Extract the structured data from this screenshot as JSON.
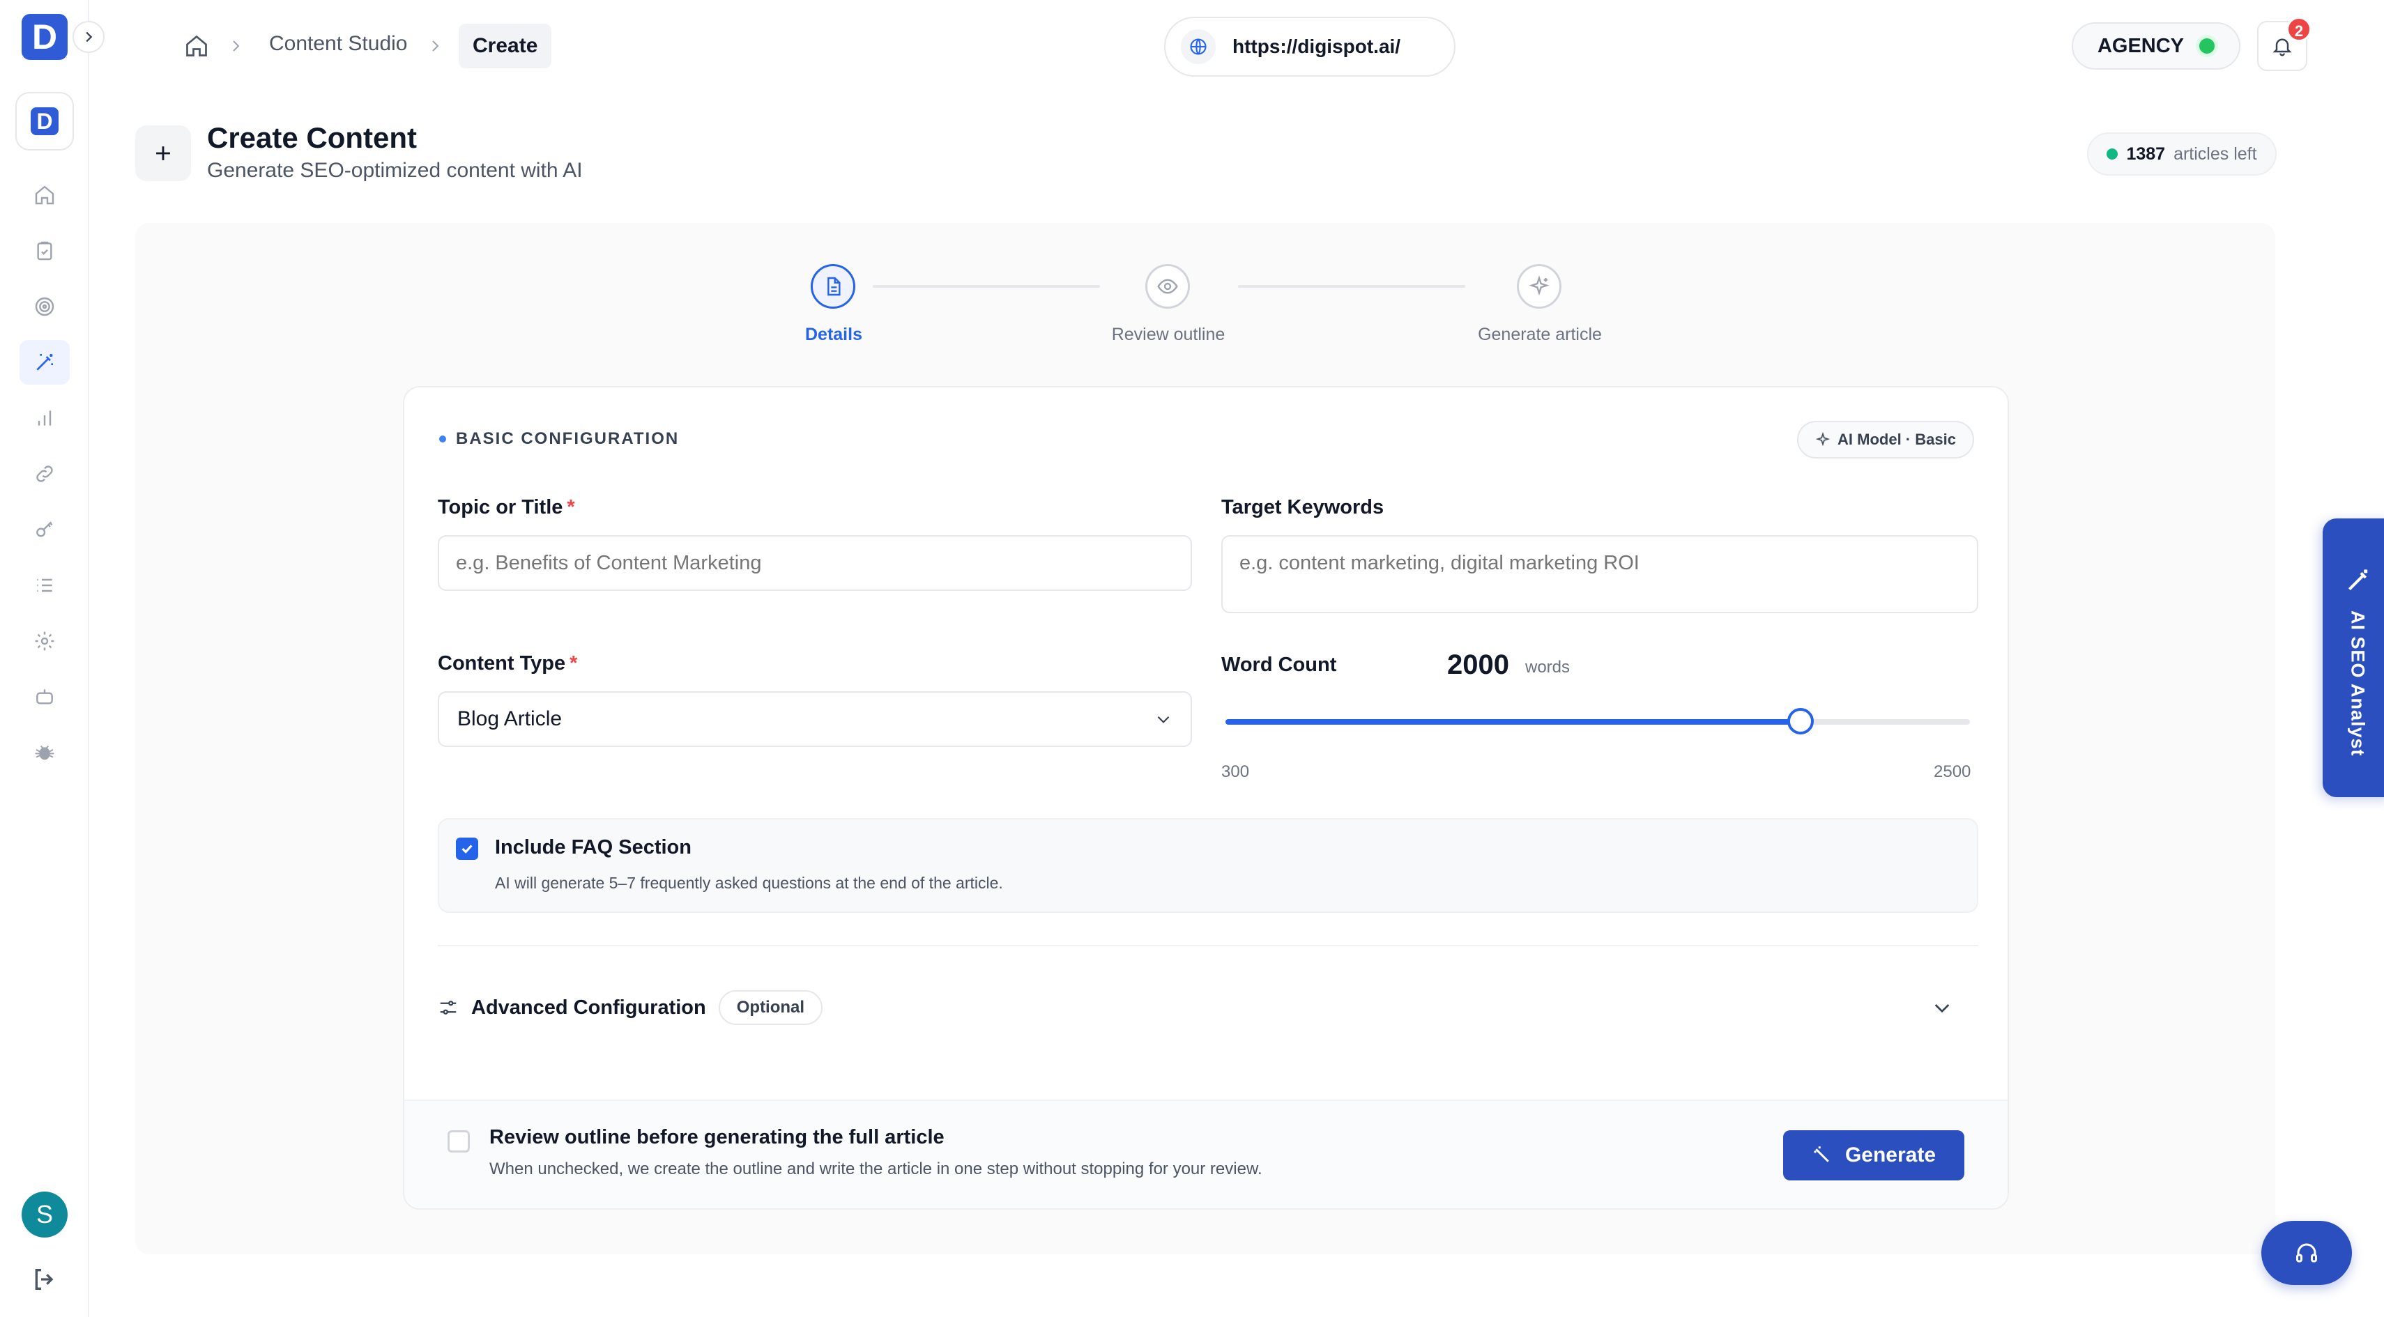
{
  "app": {
    "logo_letter": "D",
    "workspace_letter": "D"
  },
  "breadcrumb": {
    "items": [
      "Content Studio"
    ],
    "current": "Create"
  },
  "site": {
    "url": "https://digispot.ai/"
  },
  "plan": {
    "label": "AGENCY"
  },
  "notifications": {
    "count": "2"
  },
  "page": {
    "title": "Create Content",
    "subtitle": "Generate SEO-optimized content with AI",
    "articles_left_count": "1387",
    "articles_left_label": "articles left"
  },
  "stepper": {
    "steps": [
      {
        "label": "Details",
        "icon": "document-icon",
        "state": "active"
      },
      {
        "label": "Review outline",
        "icon": "eye-icon",
        "state": "pending"
      },
      {
        "label": "Generate article",
        "icon": "sparkle-icon",
        "state": "pending"
      }
    ]
  },
  "form": {
    "section_label": "BASIC CONFIGURATION",
    "ai_model": "AI Model · Basic",
    "topic": {
      "label": "Topic or Title",
      "required_mark": "*",
      "placeholder": "e.g. Benefits of Content Marketing",
      "value": ""
    },
    "keywords": {
      "label": "Target Keywords",
      "placeholder": "e.g. content marketing, digital marketing ROI",
      "value": ""
    },
    "content_type": {
      "label": "Content Type",
      "required_mark": "*",
      "value": "Blog Article"
    },
    "word_count": {
      "label": "Word Count",
      "value": 2000,
      "display": "2000",
      "unit": "words",
      "min": 300,
      "max": 2500,
      "min_label": "300",
      "max_label": "2500"
    },
    "faq": {
      "label": "Include FAQ Section",
      "description": "AI will generate 5–7 frequently asked questions at the end of the article.",
      "checked": true
    },
    "advanced": {
      "label": "Advanced Configuration",
      "badge": "Optional"
    }
  },
  "footer": {
    "review_label": "Review outline before generating the full article",
    "review_description": "When unchecked, we create the outline and write the article in one step without stopping for your review.",
    "review_checked": false,
    "generate_label": "Generate"
  },
  "side_tab": {
    "label": "AI SEO Analyst"
  },
  "user": {
    "avatar_letter": "S"
  },
  "colors": {
    "accent": "#2563eb",
    "brand": "#2c4fbf",
    "success": "#22c55e",
    "danger": "#ef4444"
  }
}
